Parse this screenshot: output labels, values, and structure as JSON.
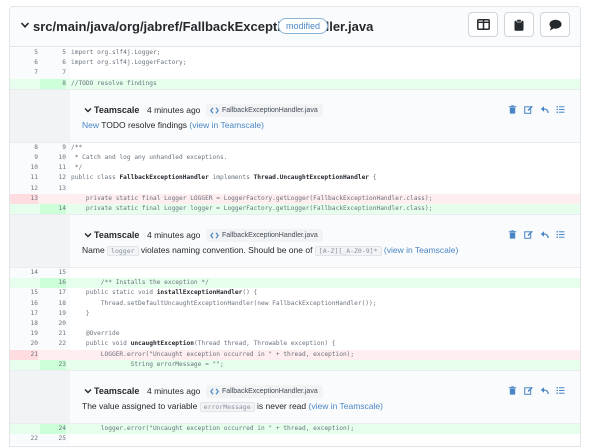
{
  "file": {
    "path": "src/main/java/org/jabref/FallbackExceptionHandler.java",
    "status": "modified",
    "buttons": {
      "split": "split-view-icon",
      "clipboard": "clipboard-icon",
      "comment": "comment-icon"
    }
  },
  "diff": {
    "block1": [
      {
        "old": "5",
        "new": "5",
        "type": "ctx",
        "code": "import org.slf4j.Logger;"
      },
      {
        "old": "6",
        "new": "6",
        "type": "ctx",
        "code": "import org.slf4j.LoggerFactory;"
      },
      {
        "old": "7",
        "new": "7",
        "type": "ctx",
        "code": ""
      },
      {
        "old": "",
        "new": "8",
        "type": "added",
        "code": "//TODO resolve findings"
      }
    ],
    "block2": [
      {
        "old": "8",
        "new": "9",
        "type": "ctx",
        "code": "/**"
      },
      {
        "old": "9",
        "new": "10",
        "type": "ctx",
        "code": " * Catch and log any unhandled exceptions."
      },
      {
        "old": "10",
        "new": "11",
        "type": "ctx",
        "code": " */"
      },
      {
        "old": "11",
        "new": "12",
        "type": "ctx",
        "code": "public class FallbackExceptionHandler implements Thread.UncaughtExceptionHandler {"
      },
      {
        "old": "12",
        "new": "13",
        "type": "ctx",
        "code": ""
      },
      {
        "old": "13",
        "new": "",
        "type": "removed",
        "code": "    private static final Logger LOGGER = LoggerFactory.getLogger(FallbackExceptionHandler.class);"
      },
      {
        "old": "",
        "new": "14",
        "type": "added",
        "code": "    private static final Logger logger = LoggerFactory.getLogger(FallbackExceptionHandler.class);"
      }
    ],
    "block3": [
      {
        "old": "14",
        "new": "15",
        "type": "ctx",
        "code": ""
      },
      {
        "old": "",
        "new": "16",
        "type": "added",
        "code": "        /** Installs the exception */"
      },
      {
        "old": "15",
        "new": "17",
        "type": "ctx",
        "code": "    public static void installExceptionHandler() {"
      },
      {
        "old": "16",
        "new": "18",
        "type": "ctx",
        "code": "        Thread.setDefaultUncaughtExceptionHandler(new FallbackExceptionHandler());"
      },
      {
        "old": "17",
        "new": "19",
        "type": "ctx",
        "code": "    }"
      },
      {
        "old": "18",
        "new": "20",
        "type": "ctx",
        "code": ""
      },
      {
        "old": "19",
        "new": "21",
        "type": "ctx",
        "code": "    @Override"
      },
      {
        "old": "20",
        "new": "22",
        "type": "ctx",
        "code": "    public void uncaughtException(Thread thread, Throwable exception) {"
      },
      {
        "old": "21",
        "new": "",
        "type": "removed",
        "code": "        LOGGER.error(\"Uncaught exception occurred in \" + thread, exception);"
      },
      {
        "old": "",
        "new": "23",
        "type": "added",
        "code": "                String errorMessage = \"\";"
      }
    ],
    "block4": [
      {
        "old": "",
        "new": "24",
        "type": "added",
        "code": "        logger.error(\"Uncaught exception occurred in \" + thread, exception);"
      },
      {
        "old": "22",
        "new": "25",
        "type": "ctx",
        "code": ""
      }
    ]
  },
  "findings": [
    {
      "author": "Teamscale",
      "time": "4 minutes ago",
      "file": "FallbackExceptionHandler.java",
      "msg_prefix": "New",
      "msg_text": " TODO resolve findings ",
      "link": "(view in Teamscale)"
    },
    {
      "author": "Teamscale",
      "time": "4 minutes ago",
      "file": "FallbackExceptionHandler.java",
      "msg_a": "Name ",
      "msg_code1": "logger",
      "msg_b": " violates naming convention. Should be one of ",
      "msg_code2": "[A-Z][_A-Z0-9]*",
      "link": "(view in Teamscale)"
    },
    {
      "author": "Teamscale",
      "time": "4 minutes ago",
      "file": "FallbackExceptionHandler.java",
      "msg_a": "The value assigned to variable ",
      "msg_code1": "errorMessage",
      "msg_b": " is never read ",
      "link": "(view in Teamscale)"
    }
  ],
  "finding_actions": [
    "trash-icon",
    "edit-icon",
    "reply-icon",
    "list-icon"
  ]
}
